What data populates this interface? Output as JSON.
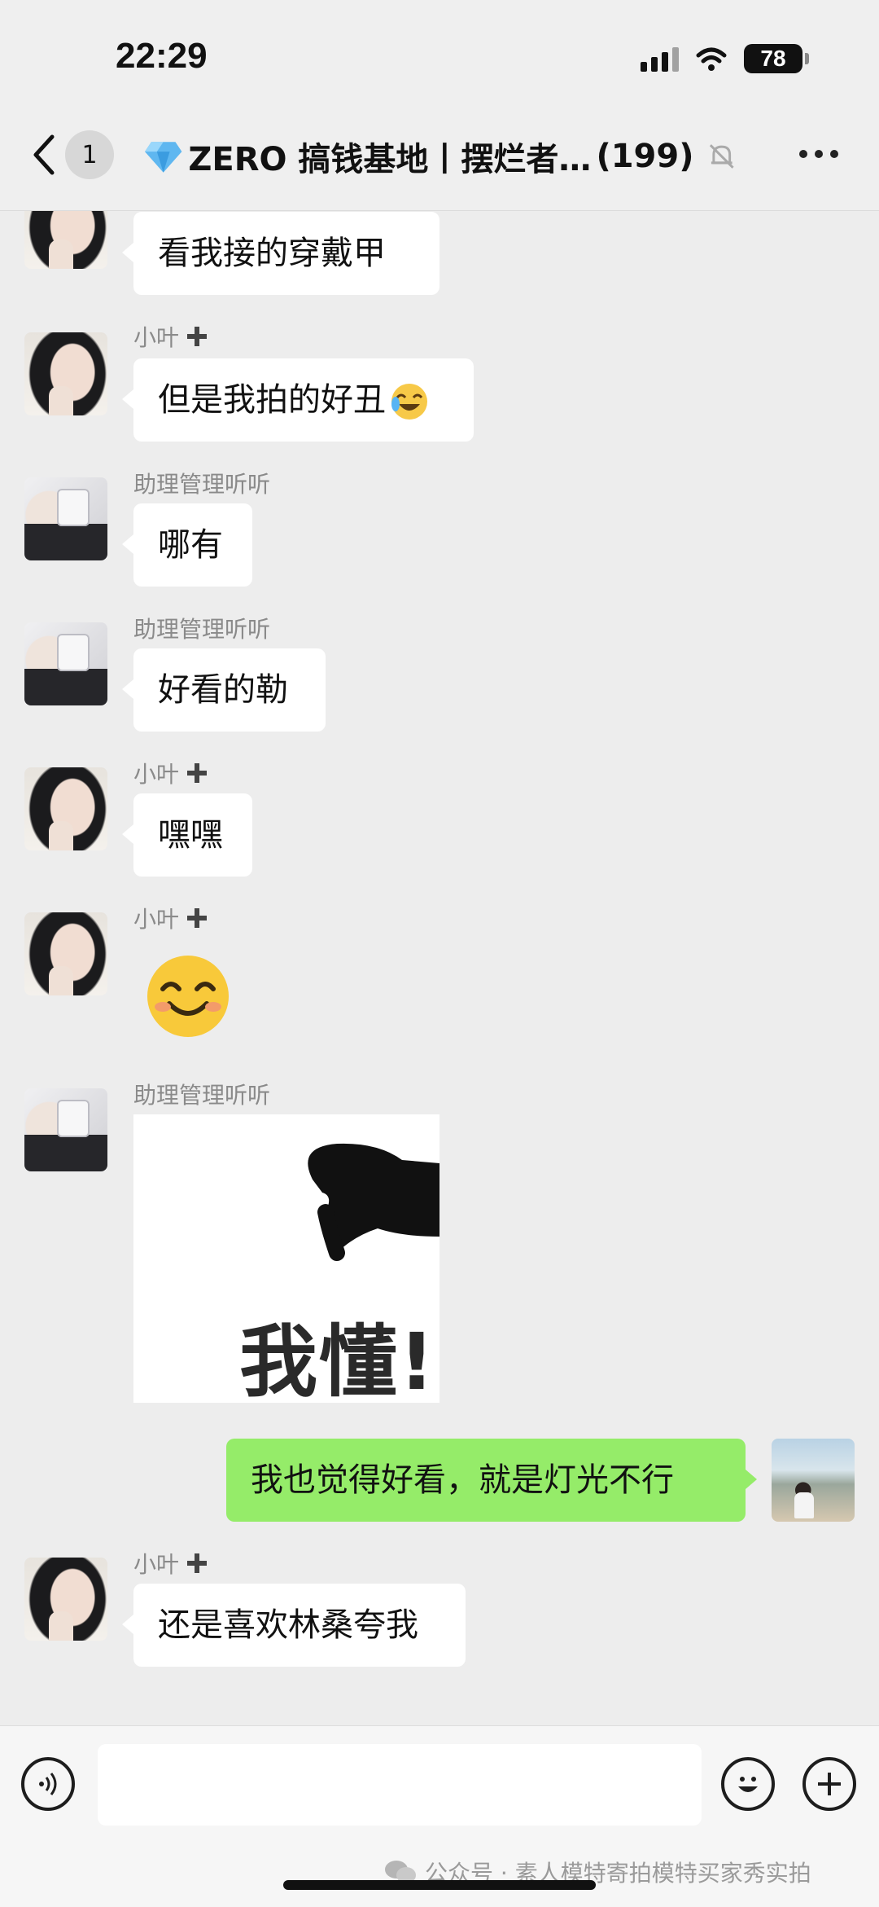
{
  "status": {
    "time": "22:29",
    "battery": "78"
  },
  "nav": {
    "back_count": "1",
    "title": "ZERO 搞钱基地丨摆烂者…",
    "member_count": "(199)"
  },
  "messages": [
    {
      "text": "看我接的穿戴甲"
    },
    {
      "sender": "小叶",
      "text": "但是我拍的好丑"
    },
    {
      "sender": "助理管理听听",
      "text": "哪有"
    },
    {
      "sender": "助理管理听听",
      "text": "好看的勒"
    },
    {
      "sender": "小叶",
      "text": "嘿嘿"
    },
    {
      "sender": "小叶"
    },
    {
      "sender": "助理管理听听",
      "sticker_text": "我懂!"
    },
    {
      "self_text": "我也觉得好看，就是灯光不行"
    },
    {
      "sender": "小叶",
      "text": "还是喜欢林桑夸我"
    }
  ],
  "watermark": "公众号 · 素人模特寄拍模特买家秀实拍",
  "colors": {
    "self_bubble": "#95ec69",
    "background": "#ededed"
  },
  "icons": [
    "back-arrow-icon",
    "diamond-icon",
    "mute-bell-icon",
    "more-icon",
    "plus-icon",
    "voice-icon",
    "emoji-icon",
    "add-icon",
    "wechat-icon"
  ]
}
